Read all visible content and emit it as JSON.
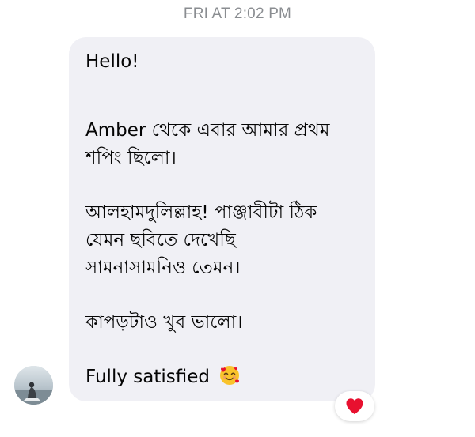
{
  "conversation": {
    "timestamp": "FRI AT 2:02 PM"
  },
  "message": {
    "sender_avatar": "avatar-photo",
    "greeting": "Hello!",
    "para1_line1": "Amber থেকে এবার আমার প্রথম",
    "para1_line2": "শপিং ছিলো।",
    "para2_line1": "আলহামদুলিল্লাহ! পাঞ্জাবীটা ঠিক",
    "para2_line2": "যেমন ছবিতে দেখেছি",
    "para2_line3": "সামনাসামনিও তেমন।",
    "para3_line1": "কাপড়টাও খুব ভালো।",
    "closing_text": "Fully satisfied",
    "closing_emoji": "smiling-face-with-hearts-icon",
    "bubble_color": "#f0f0f5",
    "text_color": "#050505"
  },
  "reaction": {
    "icon": "heart-icon",
    "color": "#e8102f"
  }
}
